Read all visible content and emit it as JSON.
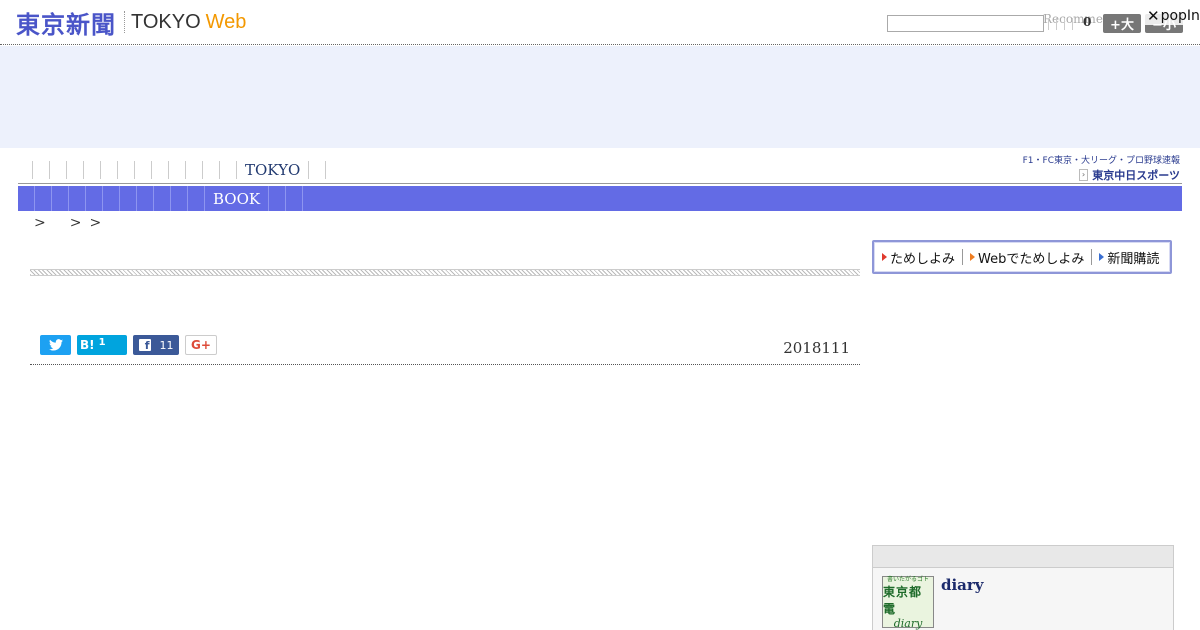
{
  "header": {
    "logo_kanji": "東京新聞",
    "logo_en": "TOKYO",
    "logo_web": "Web",
    "search_placeholder": "",
    "recommend_text": "Recommend",
    "recommend_count": "0",
    "font_plus_label": "+大",
    "font_minus_label": "−小",
    "popin_close": "✕",
    "popin_label": "popIn"
  },
  "subnav": {
    "items": [
      "",
      "",
      "",
      "",
      "",
      "",
      "",
      "",
      "",
      "",
      "",
      "",
      "TOKYO",
      ""
    ]
  },
  "chunichi": {
    "line1": "F1・FC東京・大リーグ・プロ野球速報",
    "line2": "東京中日スポーツ"
  },
  "mainnav": {
    "items": [
      "",
      "",
      "",
      "",
      "",
      "",
      "",
      "",
      "",
      "",
      "",
      "BOOK",
      "",
      ""
    ]
  },
  "breadcrumb": {
    "parts": [
      ">",
      ">",
      ">"
    ]
  },
  "share": {
    "twitter_icon": "twitter-bird",
    "hatena_mark": "B!",
    "hatena_count": "1",
    "facebook_count": "11",
    "gplus_label": "G+"
  },
  "article": {
    "date": "2018111"
  },
  "subscribe": {
    "items": [
      "ためしよみ",
      "Webでためしよみ",
      "新聞購読"
    ]
  },
  "side": {
    "diary_thumb_line1": "書いたがるゴト",
    "diary_thumb_line2": "東京都電",
    "diary_thumb_line3": "diary",
    "diary_link": "diary"
  }
}
